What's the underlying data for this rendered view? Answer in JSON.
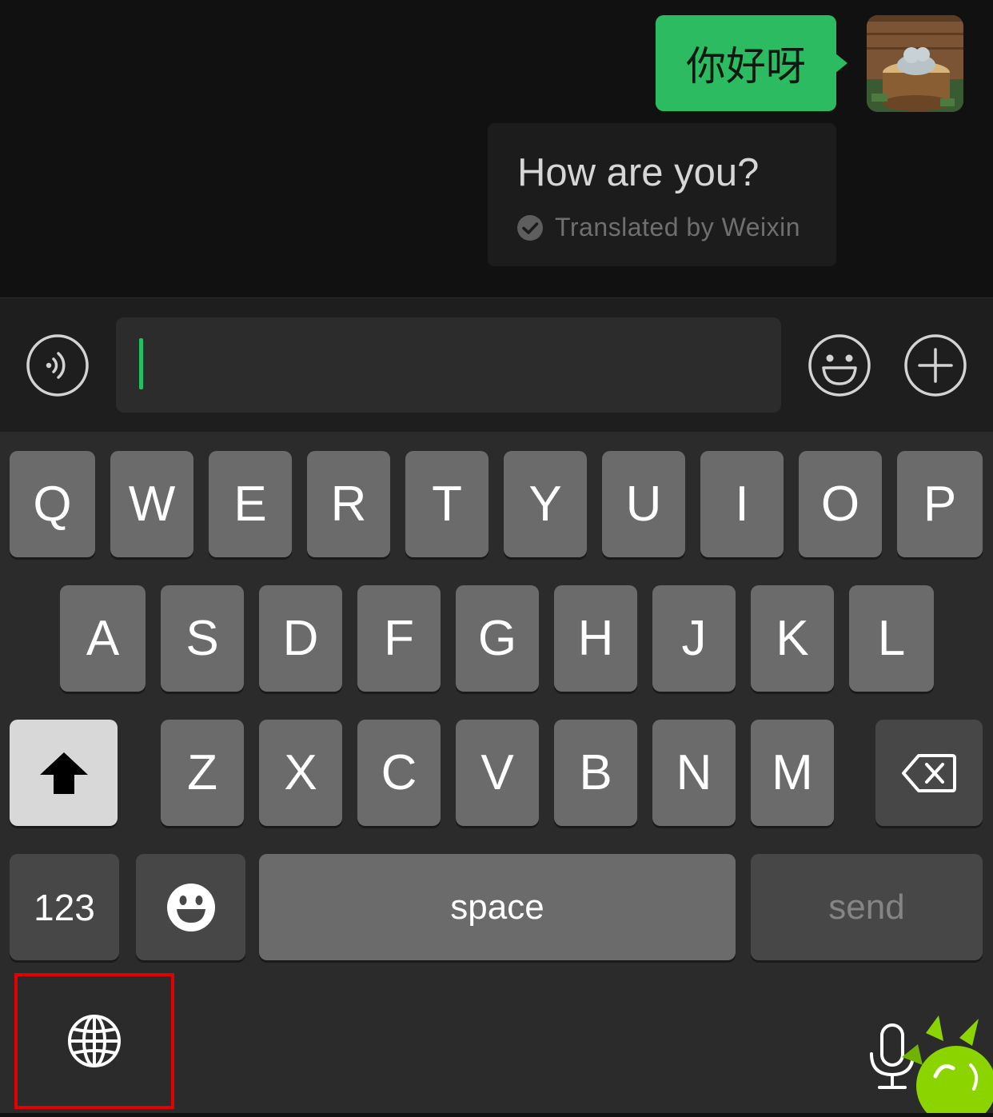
{
  "chat": {
    "message_text": "你好呀",
    "translation_text": "How are you?",
    "translation_badge": "Translated by Weixin"
  },
  "input_bar": {
    "voice_button_icon": "voice-icon",
    "emoji_button_icon": "emoji-icon",
    "more_button_icon": "plus-icon",
    "text_value": ""
  },
  "keyboard": {
    "row1": [
      "Q",
      "W",
      "E",
      "R",
      "T",
      "Y",
      "U",
      "I",
      "O",
      "P"
    ],
    "row2": [
      "A",
      "S",
      "D",
      "F",
      "G",
      "H",
      "J",
      "K",
      "L"
    ],
    "row3": [
      "Z",
      "X",
      "C",
      "V",
      "B",
      "N",
      "M"
    ],
    "numbers_label": "123",
    "space_label": "space",
    "send_label": "send",
    "shift_icon": "shift-arrow-icon",
    "delete_icon": "backspace-icon",
    "emoji_icon": "emoji-icon",
    "globe_icon": "globe-icon",
    "dictation_icon": "microphone-icon"
  },
  "colors": {
    "accent_green": "#2dbb62",
    "highlight_red": "#e30000"
  }
}
